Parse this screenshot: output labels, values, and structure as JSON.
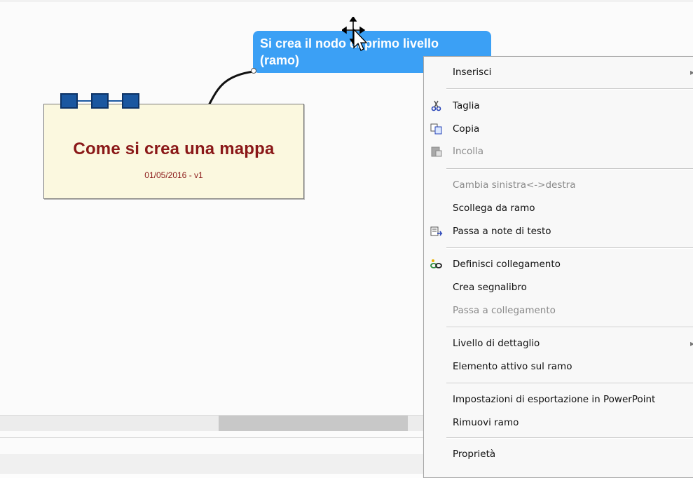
{
  "map": {
    "central_topic": {
      "title": "Come si crea una mappa",
      "subtitle": "01/05/2016 - v1"
    },
    "main_topic": {
      "line1": "Si crea il nodo di primo livello",
      "line2": "(ramo)"
    }
  },
  "context_menu": {
    "items": [
      {
        "label": "Inserisci",
        "enabled": true,
        "icon": "",
        "submenu": true
      },
      {
        "label": "Taglia",
        "enabled": true,
        "icon": "scissors-icon"
      },
      {
        "label": "Copia",
        "enabled": true,
        "icon": "copy-icon"
      },
      {
        "label": "Incolla",
        "enabled": false,
        "icon": "paste-icon"
      },
      {
        "label": "Cambia sinistra<->destra",
        "enabled": false,
        "icon": ""
      },
      {
        "label": "Scollega da ramo",
        "enabled": true,
        "icon": ""
      },
      {
        "label": "Passa a note di testo",
        "enabled": true,
        "icon": "notes-icon"
      },
      {
        "label": "Definisci collegamento",
        "enabled": true,
        "icon": "link-icon"
      },
      {
        "label": "Crea segnalibro",
        "enabled": true,
        "icon": ""
      },
      {
        "label": "Passa a collegamento",
        "enabled": false,
        "icon": ""
      },
      {
        "label": "Livello di dettaglio",
        "enabled": true,
        "icon": "",
        "submenu": true
      },
      {
        "label": "Elemento attivo sul ramo",
        "enabled": true,
        "icon": ""
      },
      {
        "label": "Impostazioni di esportazione in PowerPoint",
        "enabled": true,
        "icon": ""
      },
      {
        "label": "Rimuovi ramo",
        "enabled": true,
        "icon": ""
      },
      {
        "label": "Proprietà",
        "enabled": true,
        "icon": ""
      }
    ]
  },
  "colors": {
    "topic_blue": "#3ba0f5",
    "central_fill": "#fbf8df",
    "central_text": "#8a1818",
    "tab_blue": "#1a57a0",
    "annotation_arrow": "#c00000"
  },
  "icons": [
    "move-cursor-icon",
    "scissors-icon",
    "copy-icon",
    "paste-icon",
    "notes-icon",
    "link-icon",
    "annotation-arrow-icon"
  ]
}
